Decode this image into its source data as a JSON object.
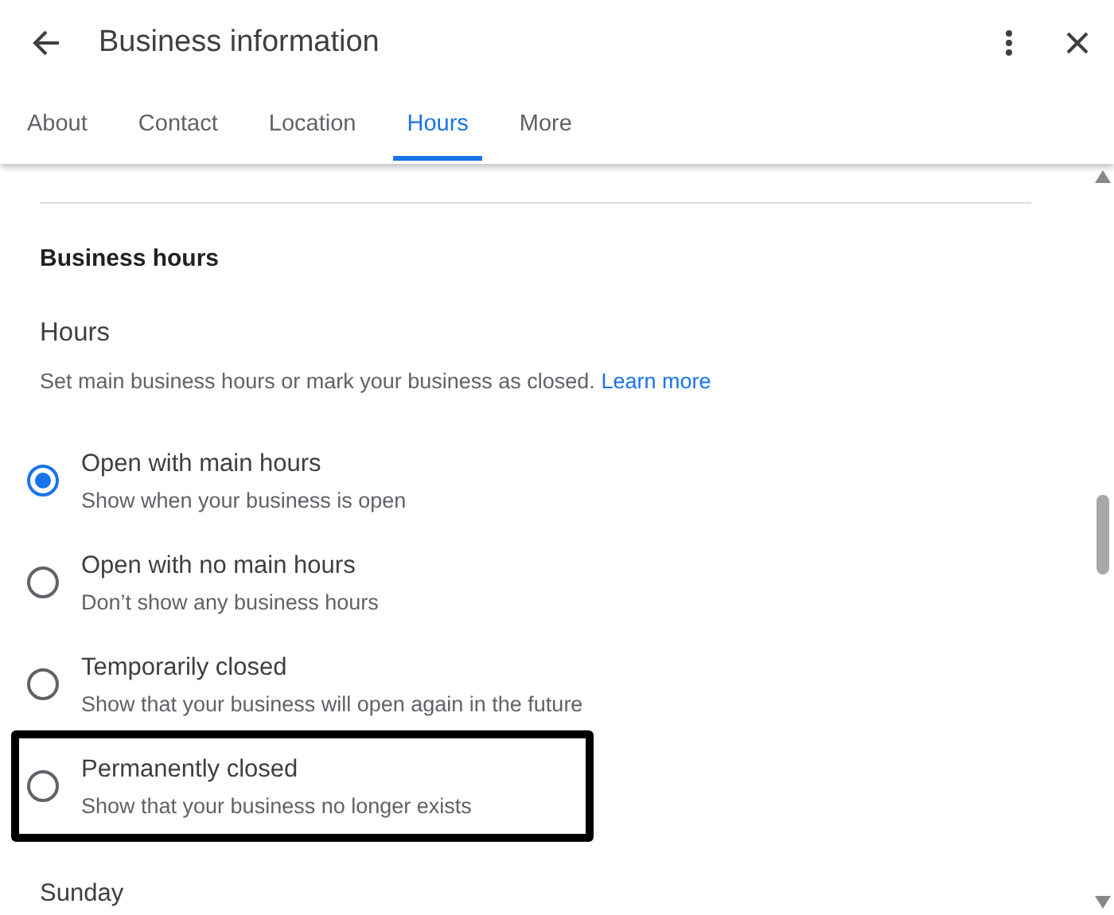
{
  "header": {
    "title": "Business information"
  },
  "tabs": [
    {
      "label": "About",
      "selected": false
    },
    {
      "label": "Contact",
      "selected": false
    },
    {
      "label": "Location",
      "selected": false
    },
    {
      "label": "Hours",
      "selected": true
    },
    {
      "label": "More",
      "selected": false
    }
  ],
  "section": {
    "title": "Business hours",
    "subtitle": "Hours",
    "description": "Set main business hours or mark your business as closed.",
    "link": "Learn more"
  },
  "options": [
    {
      "label": "Open with main hours",
      "detail": "Show when your business is open",
      "selected": true,
      "highlighted": false
    },
    {
      "label": "Open with no main hours",
      "detail": "Don’t show any business hours",
      "selected": false,
      "highlighted": false
    },
    {
      "label": "Temporarily closed",
      "detail": "Show that your business will open again in the future",
      "selected": false,
      "highlighted": false
    },
    {
      "label": "Permanently closed",
      "detail": "Show that your business no longer exists",
      "selected": false,
      "highlighted": true
    }
  ],
  "day": "Sunday"
}
